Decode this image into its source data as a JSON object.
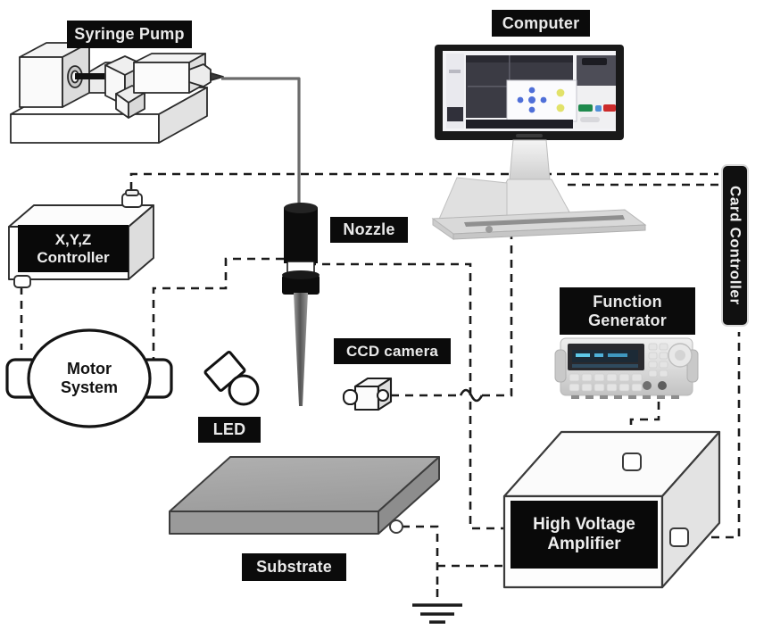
{
  "figure": {
    "title": "Electrohydrodynamic jet printing system schematic",
    "background": "#ffffff",
    "ink": "#111111",
    "label_bg": "#0b0b0b",
    "label_fg": "#e9e9e9",
    "substrate_fill": "#9e9e9e",
    "wire_style": "dashed",
    "feed_line_style": "solid"
  },
  "labels": {
    "syringe_pump": "Syringe Pump",
    "computer": "Computer",
    "card_controller": "Card Controller",
    "xyz_controller_line1": "X,Y,Z",
    "xyz_controller_line2": "Controller",
    "nozzle": "Nozzle",
    "function_generator_line1": "Function",
    "function_generator_line2": "Generator",
    "motor_system_line1": "Motor",
    "motor_system_line2": "System",
    "ccd_camera": "CCD camera",
    "led": "LED",
    "substrate": "Substrate",
    "hv_amplifier_line1": "High Voltage",
    "hv_amplifier_line2": "Amplifier"
  },
  "components": [
    {
      "id": "syringe-pump",
      "name": "Syringe Pump",
      "label": "Syringe Pump"
    },
    {
      "id": "computer",
      "name": "Computer",
      "label": "Computer"
    },
    {
      "id": "card-controller",
      "name": "Card Controller",
      "label": "Card Controller"
    },
    {
      "id": "xyz-controller",
      "name": "X,Y,Z Controller",
      "label": "X,Y,Z Controller"
    },
    {
      "id": "motor-system",
      "name": "Motor System",
      "label": "Motor System"
    },
    {
      "id": "nozzle",
      "name": "Nozzle",
      "label": "Nozzle"
    },
    {
      "id": "led",
      "name": "LED",
      "label": "LED"
    },
    {
      "id": "ccd-camera",
      "name": "CCD camera",
      "label": "CCD camera"
    },
    {
      "id": "substrate",
      "name": "Substrate",
      "label": "Substrate"
    },
    {
      "id": "function-generator",
      "name": "Function Generator",
      "label": "Function Generator"
    },
    {
      "id": "hv-amplifier",
      "name": "High Voltage Amplifier",
      "label": "High Voltage Amplifier"
    },
    {
      "id": "ground",
      "name": "Earth ground",
      "label": ""
    }
  ],
  "connections": [
    {
      "from": "syringe-pump",
      "to": "nozzle",
      "style": "solid",
      "meaning": "fluid feed tube"
    },
    {
      "from": "xyz-controller",
      "to": "card-controller",
      "style": "dashed",
      "meaning": "signal"
    },
    {
      "from": "xyz-controller",
      "to": "motor-system",
      "style": "dashed",
      "meaning": "signal"
    },
    {
      "from": "card-controller",
      "to": "computer",
      "style": "dashed",
      "meaning": "signal"
    },
    {
      "from": "nozzle",
      "to": "motor-system",
      "style": "dashed",
      "meaning": "signal"
    },
    {
      "from": "nozzle",
      "to": "hv-amplifier",
      "style": "dashed",
      "meaning": "high voltage"
    },
    {
      "from": "ccd-camera",
      "to": "computer",
      "style": "dashed",
      "meaning": "video"
    },
    {
      "from": "function-generator",
      "to": "hv-amplifier",
      "style": "dashed",
      "meaning": "waveform"
    },
    {
      "from": "function-generator",
      "to": "computer",
      "style": "dashed",
      "meaning": "control"
    },
    {
      "from": "hv-amplifier",
      "to": "card-controller",
      "style": "dashed",
      "meaning": "control"
    },
    {
      "from": "substrate",
      "to": "hv-amplifier",
      "style": "dashed",
      "meaning": "ground return"
    },
    {
      "from": "substrate",
      "to": "ground",
      "style": "dashed",
      "meaning": "earth"
    }
  ],
  "monitor": {
    "screen_desc": "control software window",
    "buttons": [
      "green",
      "blue",
      "red"
    ]
  }
}
